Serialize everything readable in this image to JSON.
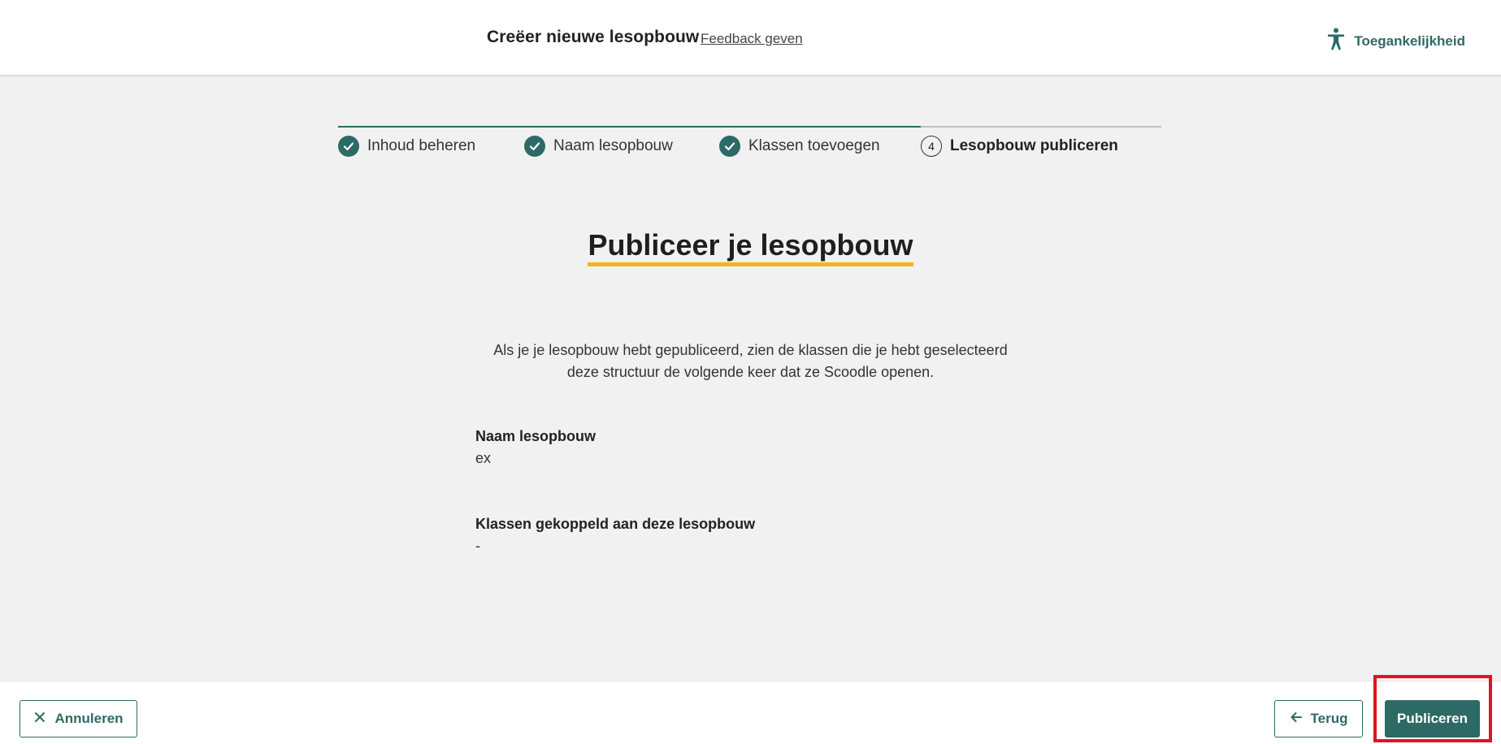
{
  "header": {
    "title": "Creëer nieuwe lesopbouw",
    "feedback_label": "Feedback geven",
    "accessibility_label": "Toegankelijkheid",
    "accessibility_icon": "accessibility-person-icon"
  },
  "stepper": {
    "steps": [
      {
        "number": "1",
        "label": "Inhoud beheren",
        "state": "completed"
      },
      {
        "number": "2",
        "label": "Naam lesopbouw",
        "state": "completed"
      },
      {
        "number": "3",
        "label": "Klassen toevoegen",
        "state": "completed"
      },
      {
        "number": "4",
        "label": "Lesopbouw publiceren",
        "state": "current"
      }
    ]
  },
  "main": {
    "heading": "Publiceer je lesopbouw",
    "intro_line1": "Als je je lesopbouw hebt gepubliceerd, zien de klassen die je hebt geselecteerd",
    "intro_line2": "deze structuur de volgende keer dat ze Scoodle openen.",
    "name_label": "Naam lesopbouw",
    "name_value": "ex",
    "classes_label": "Klassen gekoppeld aan deze lesopbouw",
    "classes_value": "-"
  },
  "footer": {
    "cancel_label": "Annuleren",
    "back_label": "Terug",
    "publish_label": "Publiceren"
  },
  "colors": {
    "accent": "#2d6a66",
    "heading_underline": "#f5b51e",
    "highlight": "#e0141e",
    "background": "#f0f1f0"
  }
}
